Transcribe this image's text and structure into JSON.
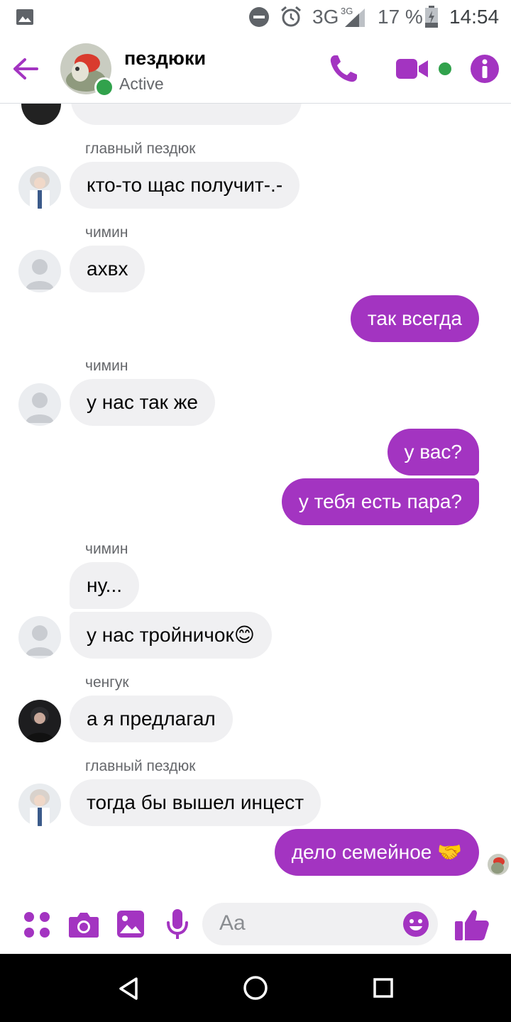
{
  "status_bar": {
    "network": "3G",
    "network_small": "3G",
    "battery": "17 %",
    "time": "14:54",
    "icons": [
      "gallery-icon",
      "dnd-icon",
      "alarm-icon",
      "signal-icon",
      "battery-icon"
    ]
  },
  "header": {
    "title": "пездюки",
    "status": "Active",
    "icons": [
      "back-arrow-icon",
      "phone-icon",
      "video-icon",
      "info-icon"
    ],
    "accent": "#a334c1",
    "online_color": "#31a24c"
  },
  "messages": {
    "m1_sender": "главный пездюк",
    "m1_text": "кто-то щас получит-.-",
    "m2_sender": "чимин",
    "m2_text": "ахвх",
    "m3_text": "так всегда",
    "m4_sender": "чимин",
    "m4_text": "у нас так же",
    "m5_text": "у вас?",
    "m6_text": "у тебя есть пара?",
    "m7_sender": "чимин",
    "m7_text": "ну...",
    "m8_text": "у нас тройничок😊",
    "m9_sender": "ченгук",
    "m9_text": "а я предлагал",
    "m10_sender": "главный пездюк",
    "m10_text": "тогда бы вышел инцест",
    "m11_text": "дело семейное 🤝"
  },
  "composer": {
    "placeholder": "Aa",
    "icons": [
      "apps-icon",
      "camera-icon",
      "image-icon",
      "mic-icon",
      "emoji-icon",
      "thumbs-up-icon"
    ]
  },
  "nav_bar": {
    "icons": [
      "back-triangle-icon",
      "home-circle-icon",
      "recents-square-icon"
    ]
  }
}
